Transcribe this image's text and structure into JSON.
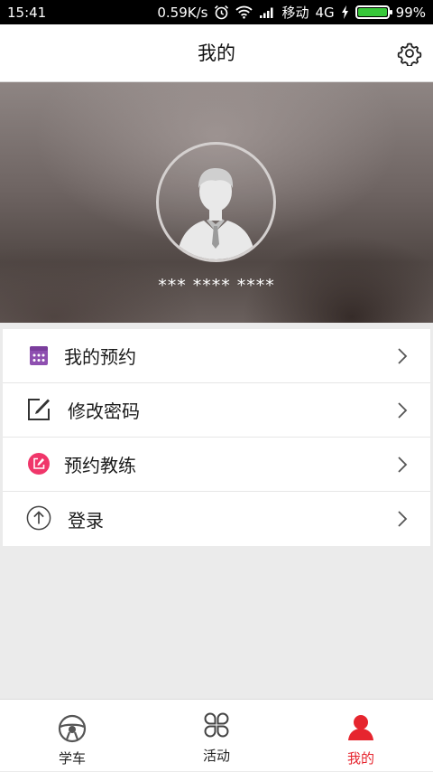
{
  "status_bar": {
    "time": "15:41",
    "network_speed": "0.59K/s",
    "carrier": "移动",
    "network_type": "4G",
    "battery": "99%",
    "icons": [
      "alarm-icon",
      "wifi-icon",
      "signal-icon",
      "charging-icon",
      "battery-icon"
    ],
    "battery_color": "#37c839"
  },
  "header": {
    "title": "我的",
    "settings_icon": "gear-icon"
  },
  "profile": {
    "avatar_icon": "user-avatar-icon",
    "masked_phone": "*** **** ****"
  },
  "menu": {
    "items": [
      {
        "label": "我的预约",
        "icon": "calendar-icon",
        "icon_color": "#8e4fb0"
      },
      {
        "label": "修改密码",
        "icon": "edit-icon",
        "icon_color": "#333333"
      },
      {
        "label": "预约教练",
        "icon": "coach-booking-icon",
        "icon_color": "#f0366a"
      },
      {
        "label": "登录",
        "icon": "arrow-up-circle-icon",
        "icon_color": "#444444"
      }
    ]
  },
  "bottom_nav": {
    "tabs": [
      {
        "label": "学车",
        "icon": "steering-wheel-icon",
        "active": false
      },
      {
        "label": "活动",
        "icon": "clover-icon",
        "active": false
      },
      {
        "label": "我的",
        "icon": "person-icon",
        "active": true
      }
    ],
    "active_color": "#e6252e"
  }
}
